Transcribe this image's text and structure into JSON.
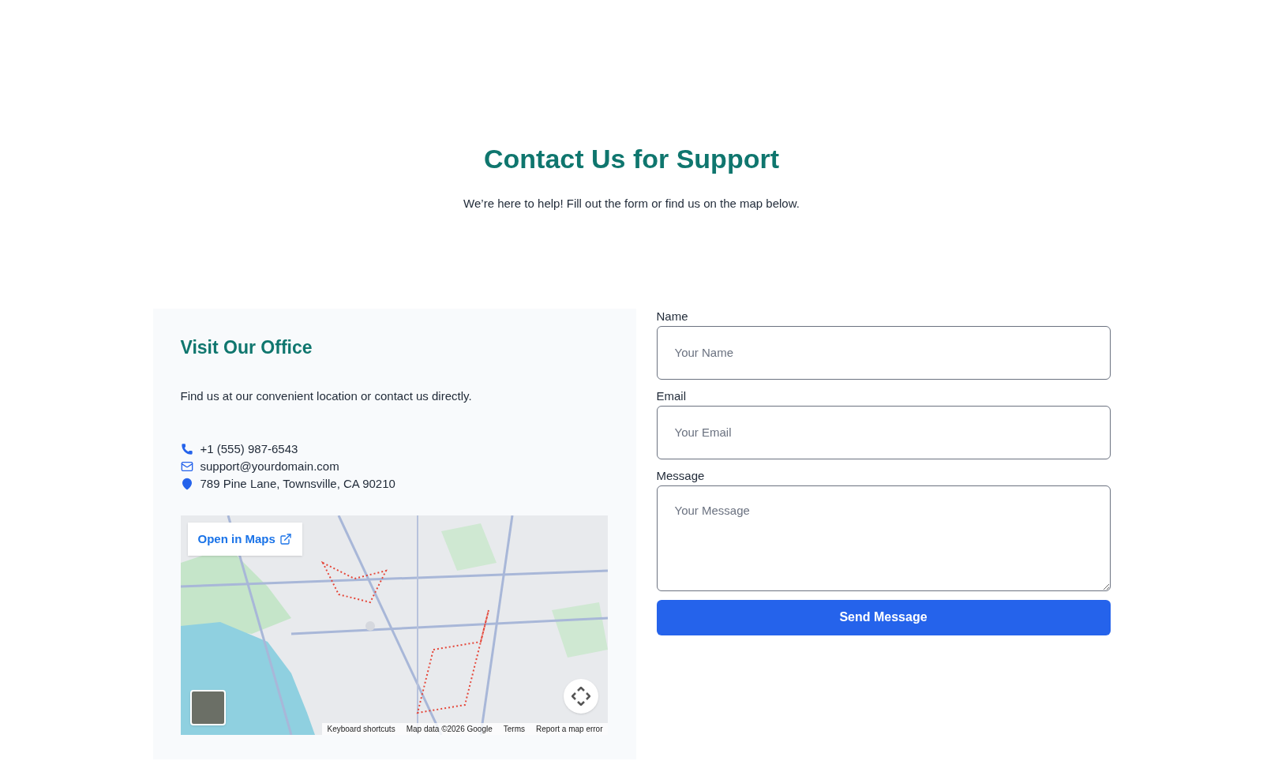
{
  "header": {
    "title": "Contact Us for Support",
    "subtitle": "We’re here to help! Fill out the form or find us on the map below."
  },
  "office": {
    "title": "Visit Our Office",
    "description": "Find us at our convenient location or contact us directly.",
    "contacts": [
      {
        "kind": "phone",
        "text": "+1 (555) 987-6543"
      },
      {
        "kind": "email",
        "text": "support@yourdomain.com"
      },
      {
        "kind": "location",
        "text": "789 Pine Lane, Townsville, CA 90210"
      }
    ],
    "map": {
      "kind": "picture",
      "open_link": "Open in Maps",
      "attribution": [
        "Keyboard shortcuts",
        "Map data ©2026 Google",
        "Terms",
        "Report a map error"
      ]
    }
  },
  "form": {
    "fields": [
      {
        "kind": "input",
        "label": "Name",
        "placeholder": "Your Name"
      },
      {
        "kind": "input",
        "label": "Email",
        "placeholder": "Your Email"
      },
      {
        "kind": "textarea",
        "label": "Message",
        "placeholder": "Your Message"
      }
    ],
    "submit": "Send Message"
  }
}
